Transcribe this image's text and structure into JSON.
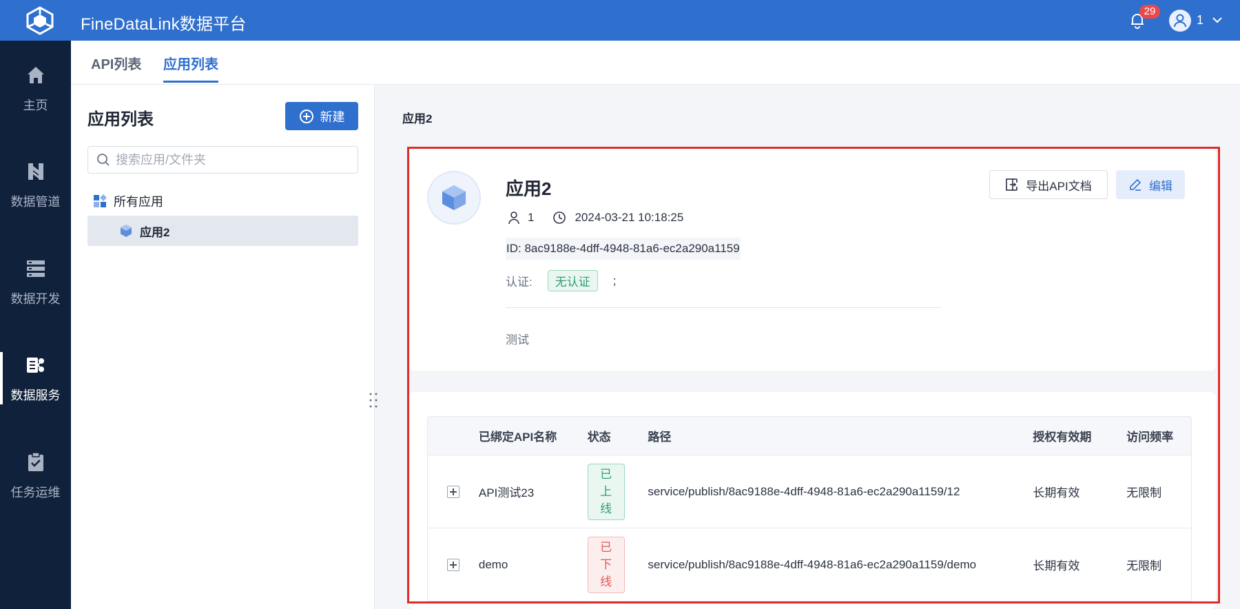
{
  "header": {
    "app_title": "FineDataLink数据平台",
    "notification_count": "29",
    "user_name": "1"
  },
  "nav": {
    "items": [
      {
        "label": "主页",
        "icon": "home-icon"
      },
      {
        "label": "数据管道",
        "icon": "pipeline-icon"
      },
      {
        "label": "数据开发",
        "icon": "dev-icon"
      },
      {
        "label": "数据服务",
        "icon": "service-icon"
      },
      {
        "label": "任务运维",
        "icon": "ops-icon"
      }
    ],
    "active": "数据服务"
  },
  "tabs": [
    {
      "label": "API列表"
    },
    {
      "label": "应用列表"
    }
  ],
  "left_panel": {
    "title": "应用列表",
    "new_button": "新建",
    "search_placeholder": "搜索应用/文件夹",
    "tree_root": "所有应用",
    "tree_child": "应用2"
  },
  "main": {
    "breadcrumb": "应用2",
    "app": {
      "name": "应用2",
      "owner": "1",
      "created": "2024-03-21 10:18:25",
      "id_text": "ID: 8ac9188e-4dff-4948-81a6-ec2a290a1159",
      "auth_label": "认证:",
      "auth_value": "无认证",
      "auth_separator": ";",
      "description": "测试",
      "export_button": "导出API文档",
      "edit_button": "编辑"
    },
    "table": {
      "headers": [
        "已绑定API名称",
        "状态",
        "路径",
        "授权有效期",
        "访问频率"
      ],
      "rows": [
        {
          "name": "API测试23",
          "status": [
            "已",
            "上",
            "线"
          ],
          "status_type": "online",
          "path": "service/publish/8ac9188e-4dff-4948-81a6-ec2a290a1159/12",
          "auth_period": "长期有效",
          "rate": "无限制"
        },
        {
          "name": "demo",
          "status": [
            "已",
            "下",
            "线"
          ],
          "status_type": "offline",
          "path": "service/publish/8ac9188e-4dff-4948-81a6-ec2a290a1159/demo",
          "auth_period": "长期有效",
          "rate": "无限制"
        }
      ]
    }
  },
  "colors": {
    "brand": "#2f6fce",
    "nav_bg": "#10213b",
    "highlight_frame": "#e02a2a"
  }
}
